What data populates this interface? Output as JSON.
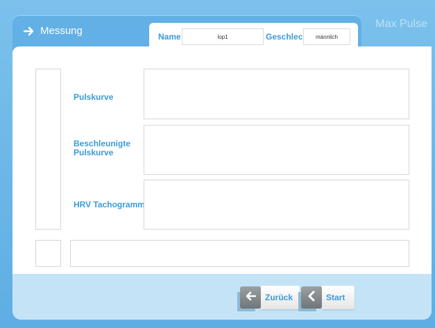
{
  "header": {
    "title": "Messung",
    "brand": "Max Pulse",
    "arrow_icon": "arrow-right-icon"
  },
  "patient": {
    "name_label": "Name",
    "name_value": "lop1",
    "gender_label": "Geschlecht",
    "gender_value": "männlich"
  },
  "charts": {
    "rows": [
      {
        "label_line1": "Pulskurve",
        "label_line2": ""
      },
      {
        "label_line1": "Beschleunigte",
        "label_line2": "Pulskurve"
      },
      {
        "label_line1": "HRV Tachogramm",
        "label_line2": ""
      }
    ]
  },
  "footer": {
    "back_label": "Zurück",
    "start_label": "Start",
    "back_icon": "arrow-left-icon",
    "start_icon": "chevron-left-icon"
  },
  "colors": {
    "frame": "#6ab5e6",
    "accent": "#3a9bd8",
    "footer": "#c5e3f6"
  }
}
